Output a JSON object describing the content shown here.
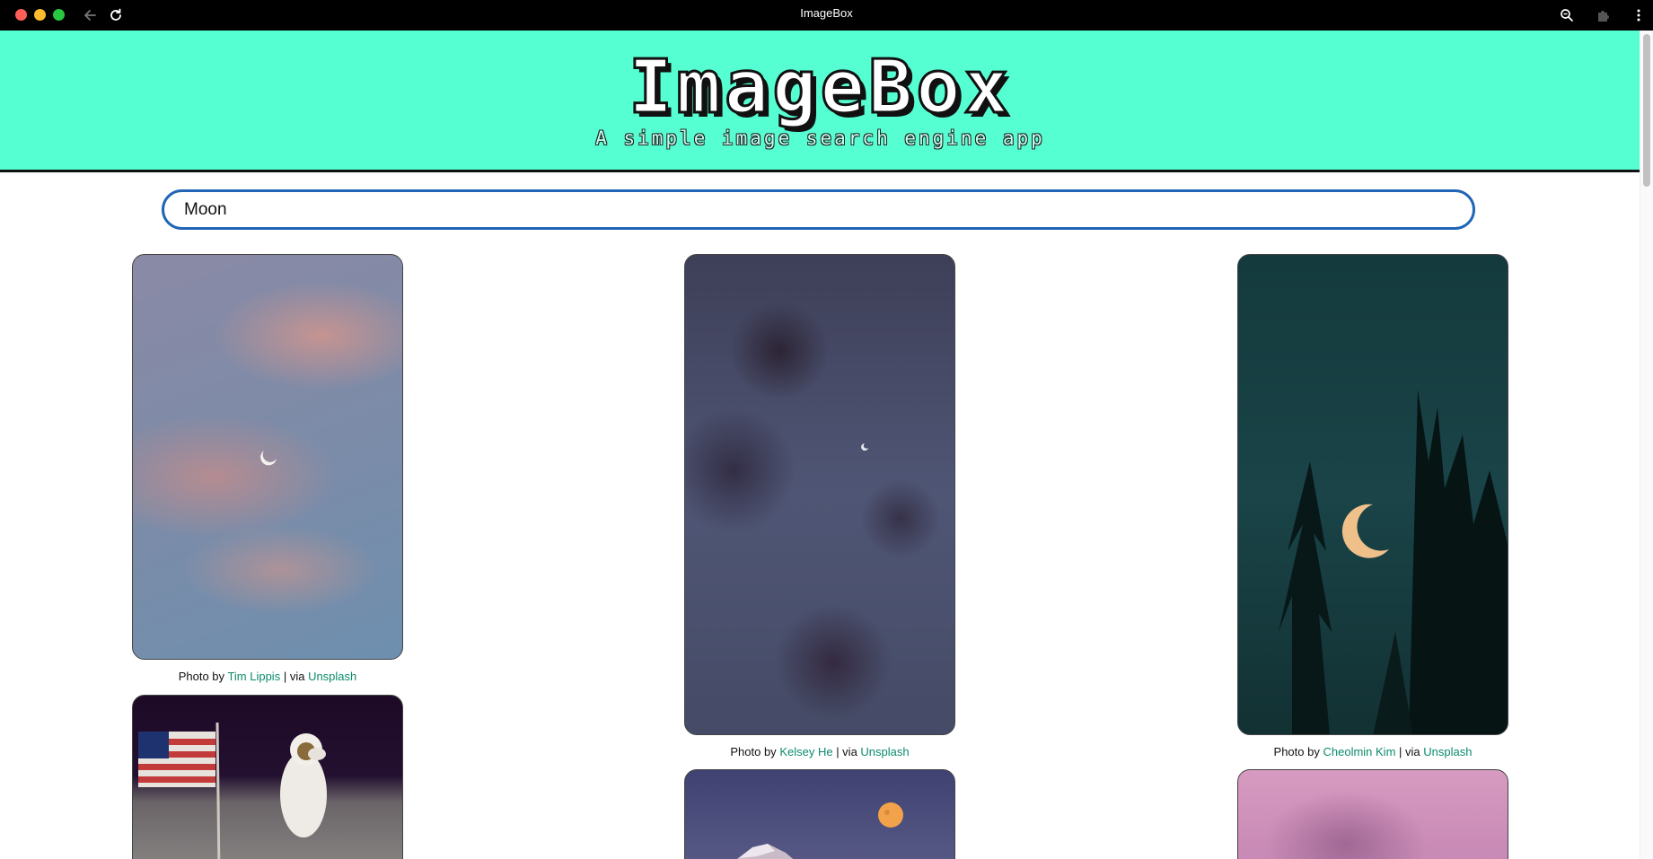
{
  "window": {
    "title": "ImageBox"
  },
  "header": {
    "logo": "ImageBox",
    "tagline": "A simple image search engine app"
  },
  "search": {
    "value": "Moon",
    "placeholder": ""
  },
  "results": [
    {
      "photographer": "Tim Lippis",
      "prefix": "Photo by",
      "separator": "| via",
      "source": "Unsplash"
    },
    {
      "photographer": "Kelsey He",
      "prefix": "Photo by",
      "separator": "| via",
      "source": "Unsplash"
    },
    {
      "photographer": "Cheolmin Kim",
      "prefix": "Photo by",
      "separator": "| via",
      "source": "Unsplash"
    }
  ],
  "colors": {
    "header_bg": "#56ffd2",
    "link": "#0b8b6a",
    "search_border": "#2165b6"
  }
}
